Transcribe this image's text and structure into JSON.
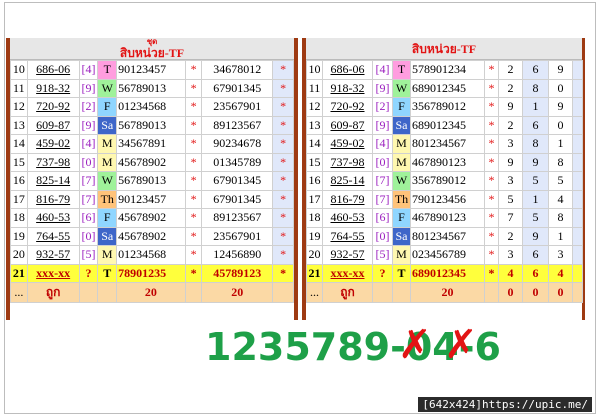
{
  "left": {
    "title_top": "ชุด",
    "title": "สิบหน่วย-TF",
    "rows": [
      {
        "n": "10",
        "pair": "686-06",
        "code": "[4]",
        "day": "T",
        "d": "tue",
        "digits": "90123457",
        "star1": "*",
        "set": "34678012",
        "star2": "*"
      },
      {
        "n": "11",
        "pair": "918-32",
        "code": "[9]",
        "day": "W",
        "d": "wed",
        "digits": "56789013",
        "star1": "*",
        "set": "67901345",
        "star2": "*"
      },
      {
        "n": "12",
        "pair": "720-92",
        "code": "[2]",
        "day": "F",
        "d": "fri",
        "digits": "01234568",
        "star1": "*",
        "set": "23567901",
        "star2": "*"
      },
      {
        "n": "13",
        "pair": "609-87",
        "code": "[9]",
        "day": "Sa",
        "d": "sat",
        "digits": "56789013",
        "star1": "*",
        "set": "89123567",
        "star2": "*"
      },
      {
        "n": "14",
        "pair": "459-02",
        "code": "[4]",
        "day": "M",
        "d": "mon",
        "digits": "34567891",
        "star1": "*",
        "set": "90234678",
        "star2": "*"
      },
      {
        "n": "15",
        "pair": "737-98",
        "code": "[0]",
        "day": "M",
        "d": "mon",
        "digits": "45678902",
        "star1": "*",
        "set": "01345789",
        "star2": "*"
      },
      {
        "n": "16",
        "pair": "825-14",
        "code": "[7]",
        "day": "W",
        "d": "wed",
        "digits": "56789013",
        "star1": "*",
        "set": "67901345",
        "star2": "*"
      },
      {
        "n": "17",
        "pair": "816-79",
        "code": "[7]",
        "day": "Th",
        "d": "thu",
        "digits": "90123457",
        "star1": "*",
        "set": "67901345",
        "star2": "*"
      },
      {
        "n": "18",
        "pair": "460-53",
        "code": "[6]",
        "day": "F",
        "d": "fri",
        "digits": "45678902",
        "star1": "*",
        "set": "89123567",
        "star2": "*"
      },
      {
        "n": "19",
        "pair": "764-55",
        "code": "[0]",
        "day": "Sa",
        "d": "sat",
        "digits": "45678902",
        "star1": "*",
        "set": "23567901",
        "star2": "*"
      },
      {
        "n": "20",
        "pair": "932-57",
        "code": "[5]",
        "day": "M",
        "d": "mon",
        "digits": "01234568",
        "star1": "*",
        "set": "12456890",
        "star2": "*"
      }
    ],
    "sum": {
      "n": "21",
      "pair": "xxx-xx",
      "code": "?",
      "day": "T",
      "digits": "78901235",
      "star1": "*",
      "set": "45789123",
      "star2": "*"
    },
    "count": {
      "n": "...",
      "label": "ถูก",
      "c1": "20",
      "c2": "20"
    }
  },
  "right": {
    "title": "สิบหน่วย-TF",
    "rows": [
      {
        "n": "10",
        "pair": "686-06",
        "code": "[4]",
        "day": "T",
        "d": "tue",
        "digits": "578901234",
        "star": "*",
        "a": "2",
        "b": "6",
        "c": "9"
      },
      {
        "n": "11",
        "pair": "918-32",
        "code": "[9]",
        "day": "W",
        "d": "wed",
        "digits": "689012345",
        "star": "*",
        "a": "2",
        "b": "8",
        "c": "0"
      },
      {
        "n": "12",
        "pair": "720-92",
        "code": "[2]",
        "day": "F",
        "d": "fri",
        "digits": "356789012",
        "star": "*",
        "a": "9",
        "b": "1",
        "c": "9"
      },
      {
        "n": "13",
        "pair": "609-87",
        "code": "[9]",
        "day": "Sa",
        "d": "sat",
        "digits": "689012345",
        "star": "*",
        "a": "2",
        "b": "6",
        "c": "0"
      },
      {
        "n": "14",
        "pair": "459-02",
        "code": "[4]",
        "day": "M",
        "d": "mon",
        "digits": "801234567",
        "star": "*",
        "a": "3",
        "b": "8",
        "c": "1"
      },
      {
        "n": "15",
        "pair": "737-98",
        "code": "[0]",
        "day": "M",
        "d": "mon",
        "digits": "467890123",
        "star": "*",
        "a": "9",
        "b": "9",
        "c": "8"
      },
      {
        "n": "16",
        "pair": "825-14",
        "code": "[7]",
        "day": "W",
        "d": "wed",
        "digits": "356789012",
        "star": "*",
        "a": "3",
        "b": "5",
        "c": "5"
      },
      {
        "n": "17",
        "pair": "816-79",
        "code": "[7]",
        "day": "Th",
        "d": "thu",
        "digits": "790123456",
        "star": "*",
        "a": "5",
        "b": "1",
        "c": "4"
      },
      {
        "n": "18",
        "pair": "460-53",
        "code": "[6]",
        "day": "F",
        "d": "fri",
        "digits": "467890123",
        "star": "*",
        "a": "7",
        "b": "5",
        "c": "8"
      },
      {
        "n": "19",
        "pair": "764-55",
        "code": "[0]",
        "day": "Sa",
        "d": "sat",
        "digits": "801234567",
        "star": "*",
        "a": "2",
        "b": "9",
        "c": "1"
      },
      {
        "n": "20",
        "pair": "932-57",
        "code": "[5]",
        "day": "M",
        "d": "mon",
        "digits": "023456789",
        "star": "*",
        "a": "3",
        "b": "6",
        "c": "3"
      }
    ],
    "sum": {
      "n": "21",
      "pair": "xxx-xx",
      "code": "?",
      "day": "T",
      "digits": "689012345",
      "star": "*",
      "a": "4",
      "b": "6",
      "c": "4",
      "dot1": "..",
      "dot2": "..",
      "dot3": ".."
    },
    "count": {
      "n": "...",
      "label": "ถูก",
      "c1": "20",
      "c2": "0",
      "c3": "0",
      "c4": "0"
    }
  },
  "bottom_text": "1235789-04-6",
  "watermark": "[642x424]https://upic.me/",
  "colors": {
    "accent_red": "#e21414",
    "frame_brown": "#9e3a12",
    "green_text": "#1ea048",
    "sum_yellow": "#ffff3c",
    "count_orange": "#fbd9a5"
  }
}
